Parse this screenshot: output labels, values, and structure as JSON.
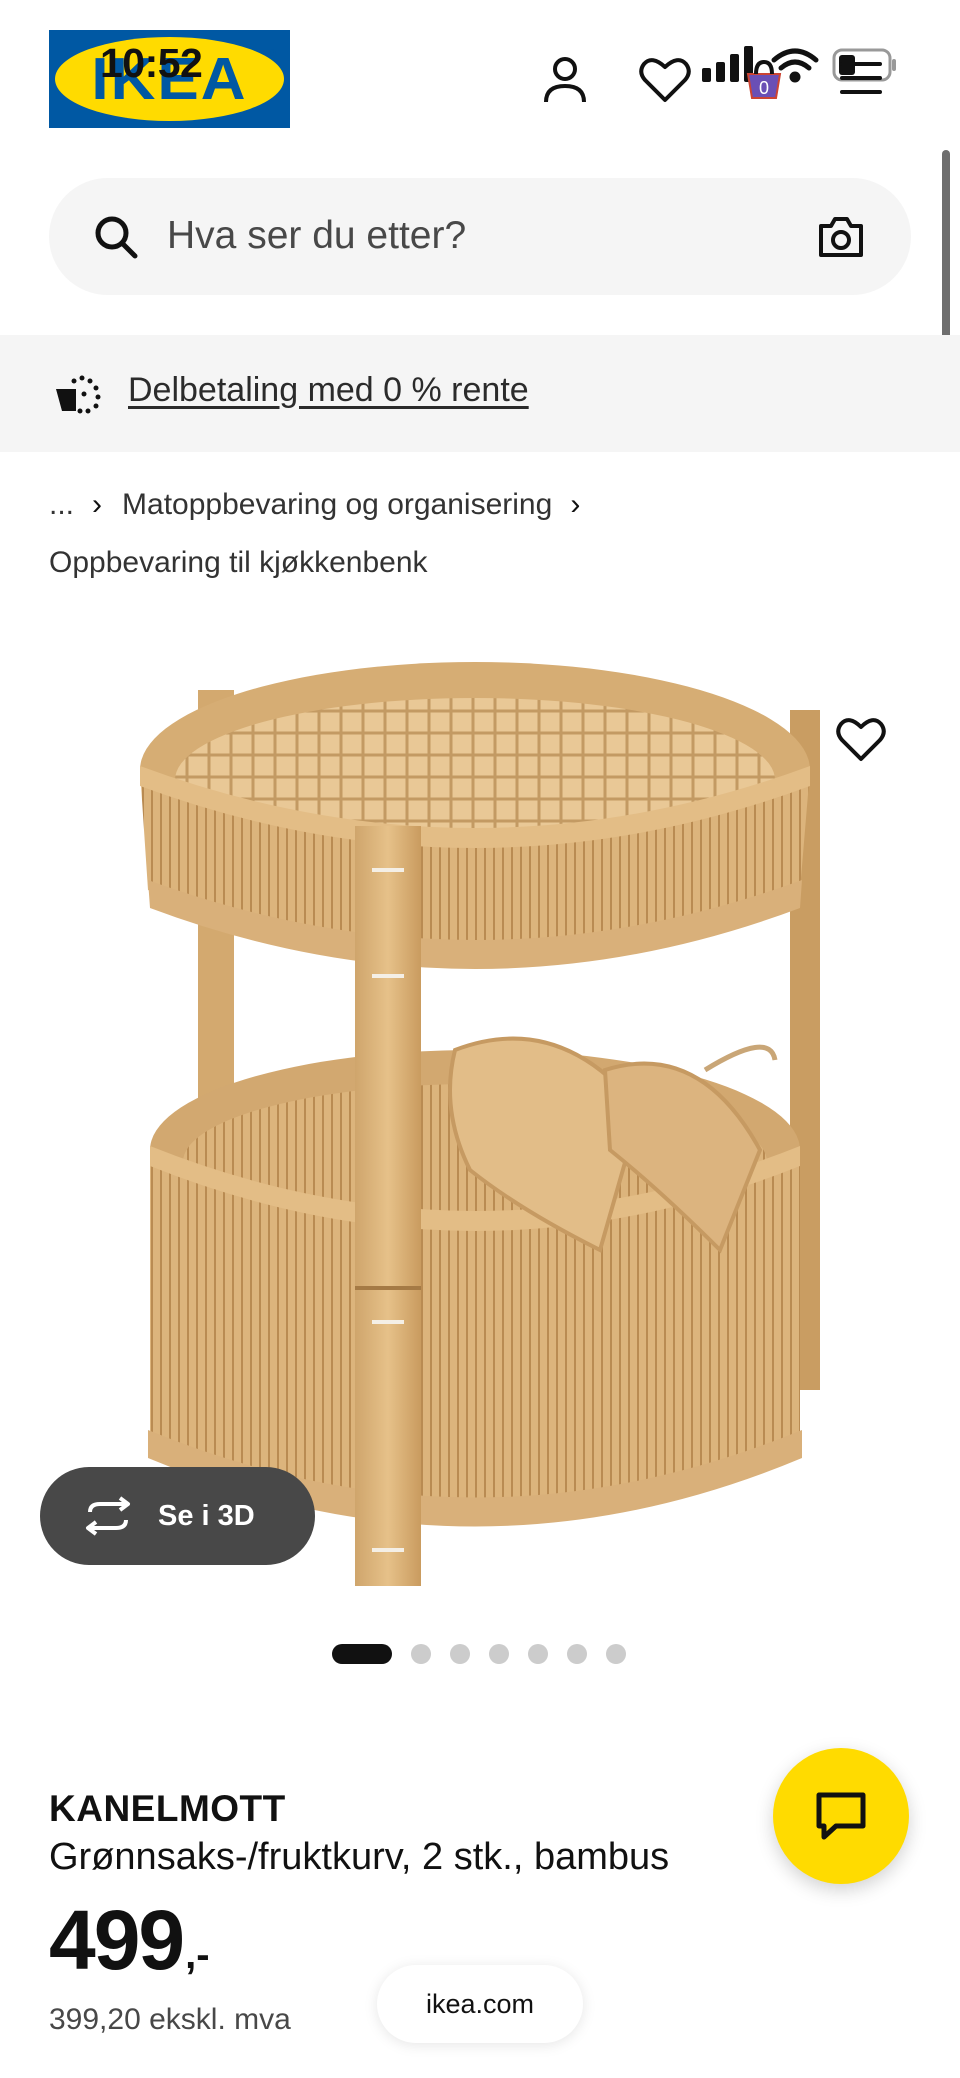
{
  "status_bar": {
    "time": "10:52",
    "icons": [
      "cellular-signal-icon",
      "wifi-icon",
      "battery-icon"
    ]
  },
  "header": {
    "logo_text": "IKEA",
    "logo_reg": "®",
    "icons": [
      "user-icon",
      "heart-icon",
      "shopping-bag-icon",
      "hamburger-menu-icon"
    ],
    "cart_count": "0",
    "colors": {
      "brand_blue": "#0058a3",
      "brand_yellow": "#ffdb00"
    }
  },
  "search": {
    "placeholder": "Hva ser du etter?",
    "value": ""
  },
  "promo": {
    "link_text": "Delbetaling med 0 % rente"
  },
  "breadcrumb": {
    "ellipsis": "...",
    "separator": "›",
    "items": [
      "Matoppbevaring og organisering",
      "Oppbevaring til kjøkkenbenk"
    ]
  },
  "gallery": {
    "view_3d_label": "Se i 3D",
    "slide_count": 7,
    "active_slide": 1
  },
  "product": {
    "name": "KANELMOTT",
    "description": "Grønnsaks-/fruktkurv, 2 stk., bambus",
    "price_integer": "499",
    "price_suffix": ",-",
    "price_ex_vat": "399,20 ekskl. mva"
  },
  "browser": {
    "url": "ikea.com"
  }
}
